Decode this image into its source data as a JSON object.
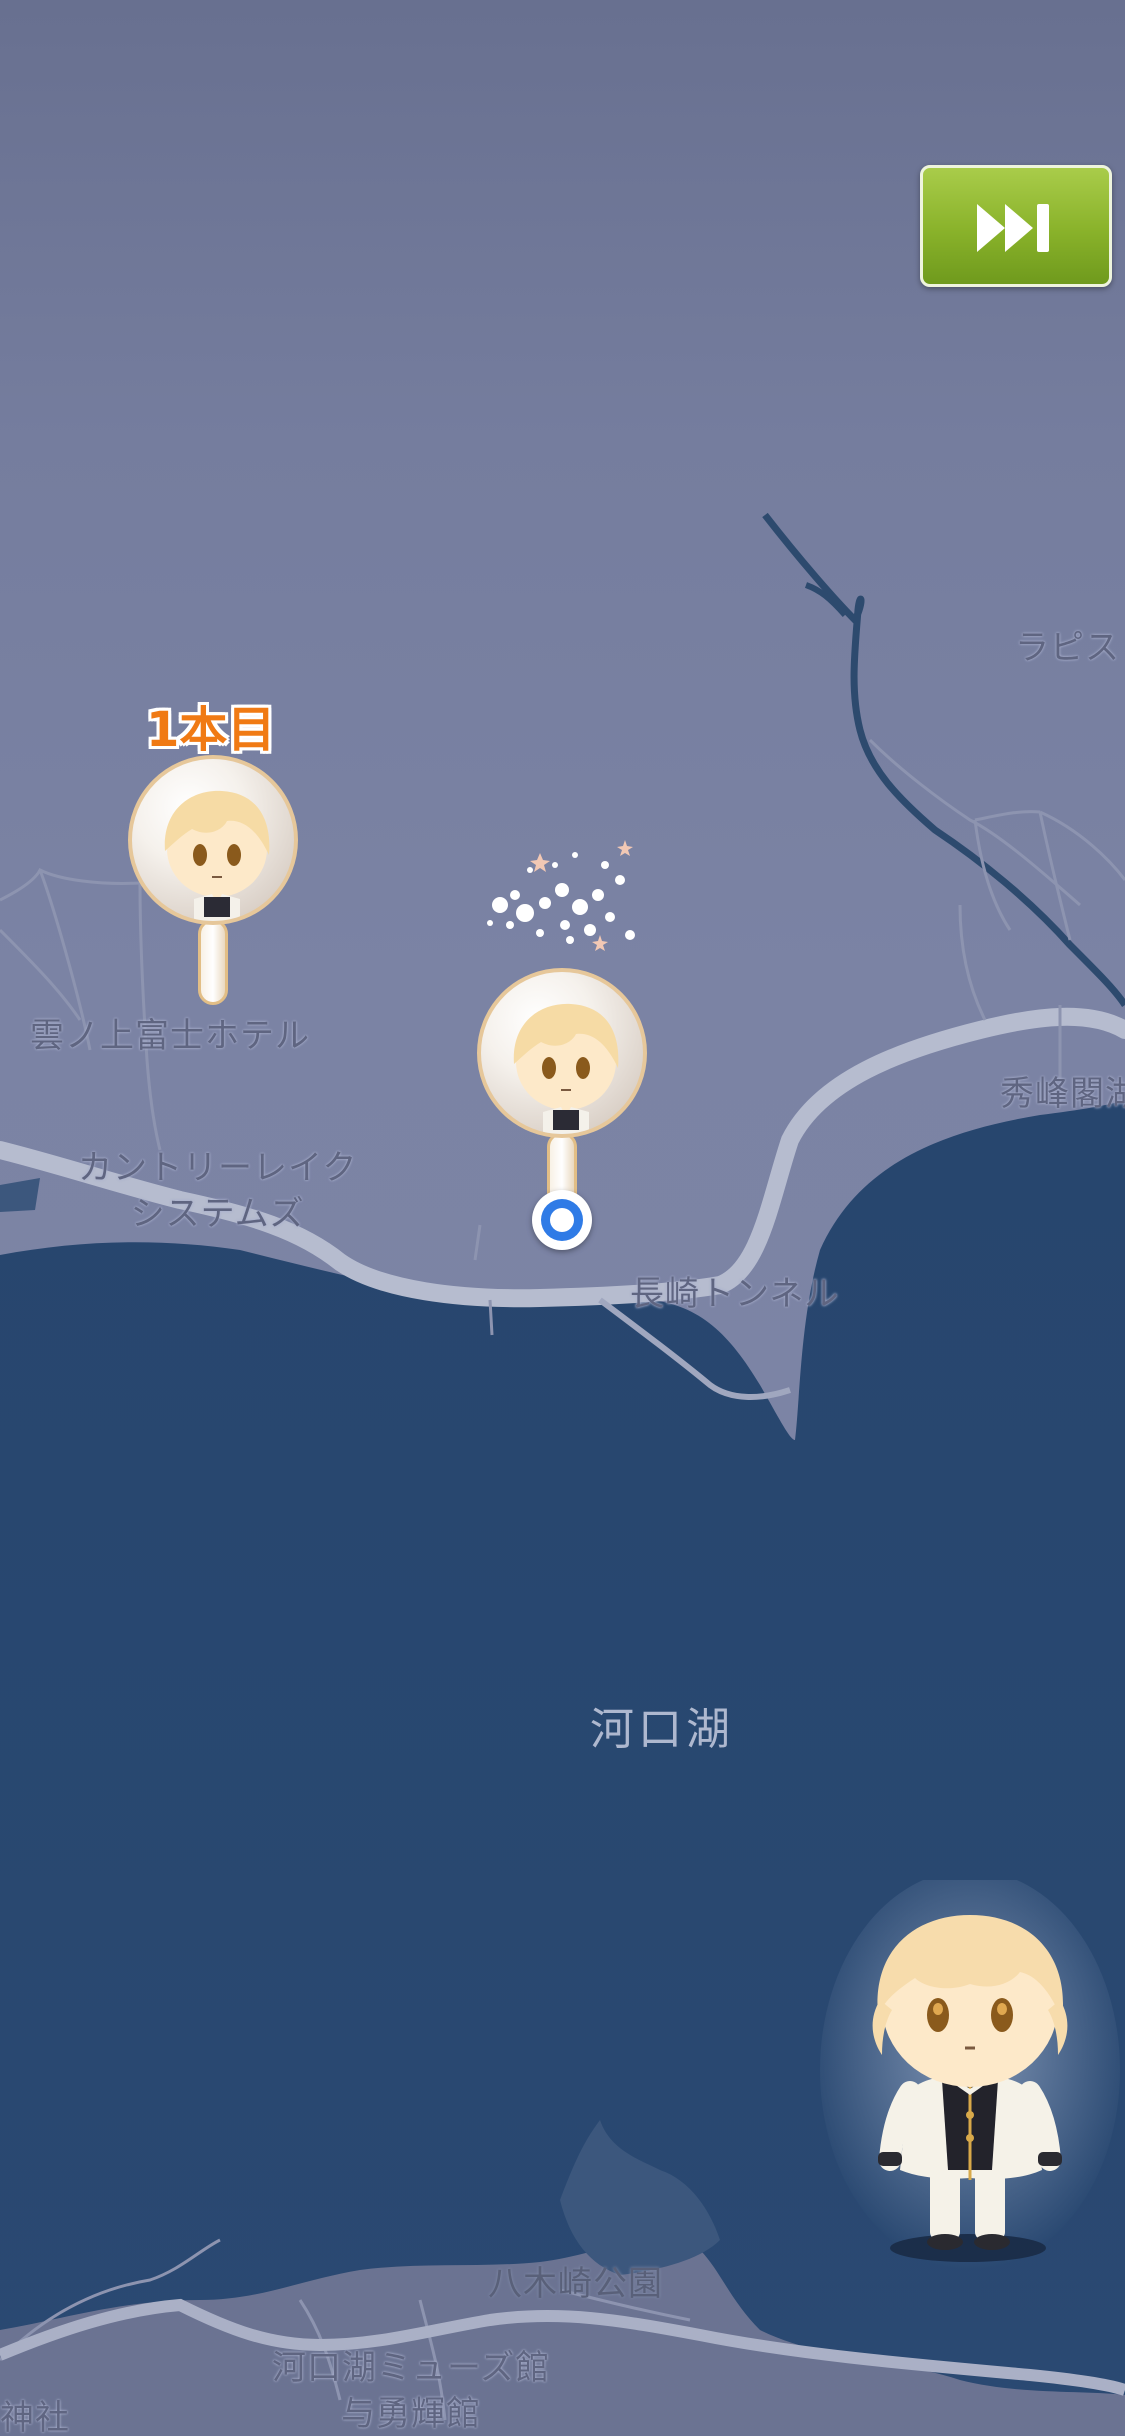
{
  "map": {
    "labels": {
      "lapis": "ラピス",
      "hotel": "雲ノ上富士ホテル",
      "country_lake_line1": "カントリーレイク",
      "country_lake_line2": "システムズ",
      "shuho": "秀峰閣湖",
      "nagasaki_tunnel": "長崎トンネル",
      "kawaguchiko": "河口湖",
      "yagisaki_park": "八木崎公園",
      "muse_line1": "河口湖ミューズ館",
      "muse_line2": "与勇輝館",
      "shrine": "神社"
    },
    "colors": {
      "land": "#7b83a4",
      "water": "#27466e",
      "road": "#b6bccf"
    }
  },
  "skip_button": {
    "icon": "fast-forward-icon",
    "color": "#8db42a"
  },
  "pins": [
    {
      "label": "1本目",
      "character": "blonde-chibi-character"
    },
    {
      "label": "",
      "character": "blonde-chibi-character"
    }
  ],
  "location_marker": {
    "color": "#2f7be6"
  },
  "avatar": {
    "character": "blonde-chibi-character-uniform"
  }
}
